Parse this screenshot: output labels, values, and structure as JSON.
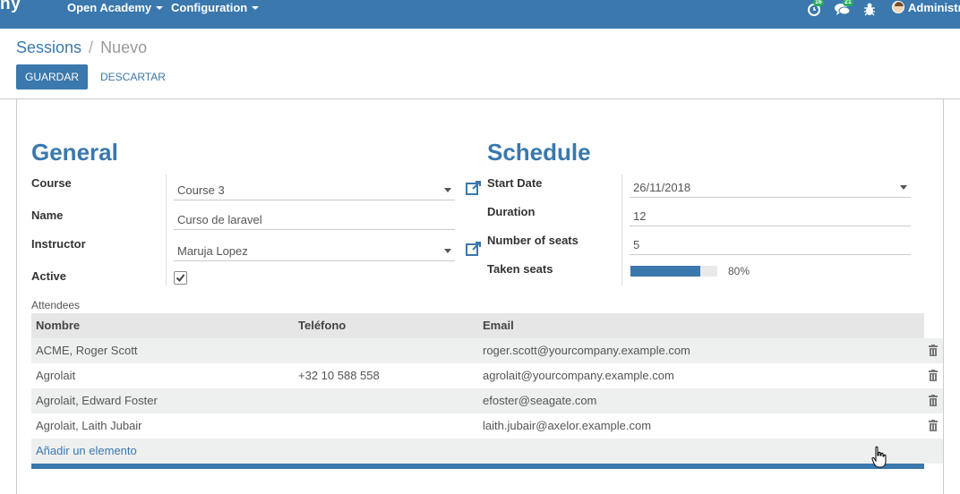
{
  "navbar": {
    "brand": "ny",
    "menu_academy": "Open Academy",
    "menu_config": "Configuration",
    "activity_badge": "16",
    "messages_badge": "21",
    "user_name": "Administra"
  },
  "breadcrumb": {
    "parent": "Sessions",
    "separator": "/",
    "current": "Nuevo"
  },
  "buttons": {
    "save": "GUARDAR",
    "discard": "DESCARTAR"
  },
  "general": {
    "title": "General",
    "course_label": "Course",
    "course_value": "Course 3",
    "name_label": "Name",
    "name_value": "Curso de laravel",
    "instructor_label": "Instructor",
    "instructor_value": "Maruja Lopez",
    "active_label": "Active",
    "active_checked": true
  },
  "schedule": {
    "title": "Schedule",
    "start_date_label": "Start Date",
    "start_date_value": "26/11/2018",
    "duration_label": "Duration",
    "duration_value": "12",
    "seats_label": "Number of seats",
    "seats_value": "5",
    "taken_label": "Taken seats",
    "taken_value": 80,
    "taken_text": "80%"
  },
  "attendees": {
    "label": "Attendees",
    "columns": [
      "Nombre",
      "Teléfono",
      "Email"
    ],
    "rows": [
      {
        "name": "ACME, Roger Scott",
        "phone": "",
        "email": "roger.scott@yourcompany.example.com"
      },
      {
        "name": "Agrolait",
        "phone": "+32 10 588 558",
        "email": "agrolait@yourcompany.example.com"
      },
      {
        "name": "Agrolait, Edward Foster",
        "phone": "",
        "email": "efoster@seagate.com"
      },
      {
        "name": "Agrolait, Laith Jubair",
        "phone": "",
        "email": "laith.jubair@axelor.example.com"
      }
    ],
    "add_line": "Añadir un elemento"
  },
  "colors": {
    "primary": "#3a78ad",
    "badge": "#27ae60"
  }
}
